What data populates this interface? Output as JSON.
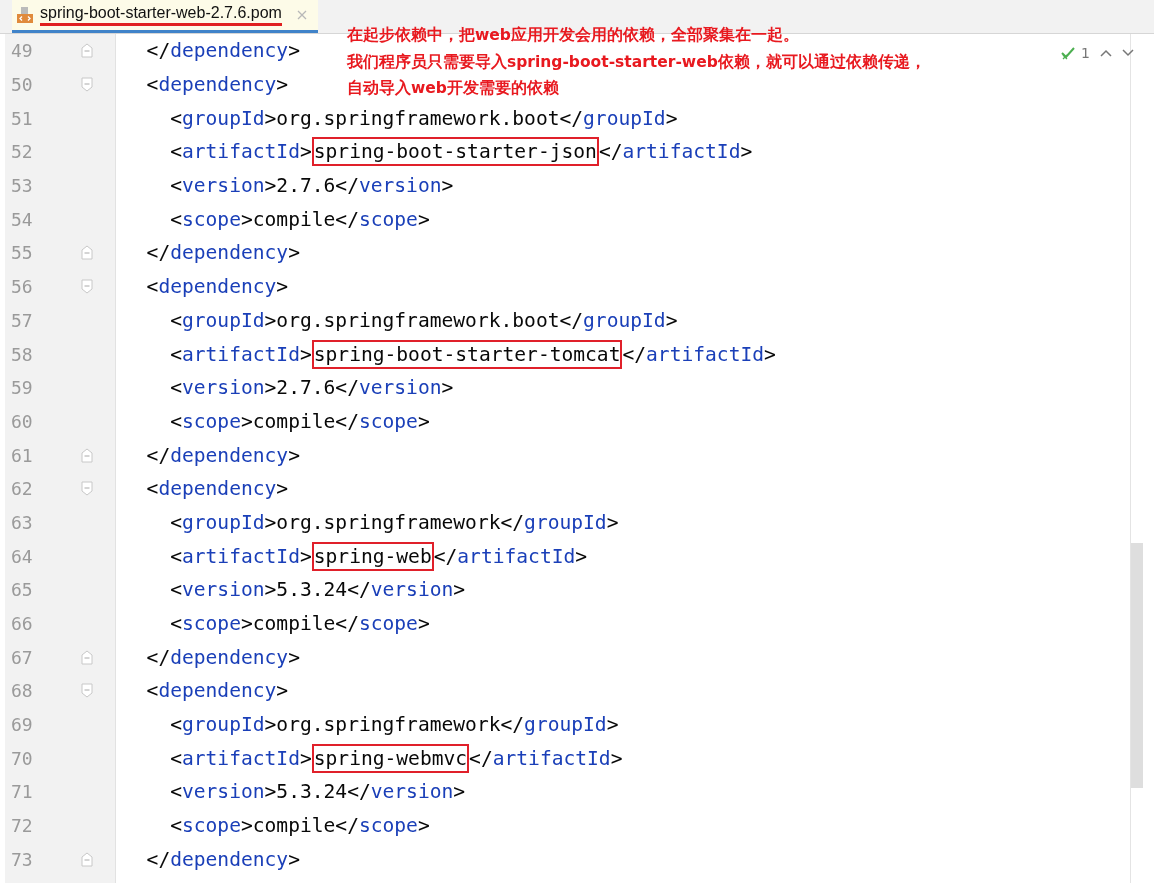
{
  "tab": {
    "title": "spring-boot-starter-web-2.7.6.pom",
    "closable": true,
    "selected": true,
    "underlined": true
  },
  "annotation": [
    "在起步依赖中，把web应用开发会用的依赖，全部聚集在一起。",
    "我们程序员只需要导入spring-boot-starter-web依赖，就可以通过依赖传递，",
    "自动导入web开发需要的依赖"
  ],
  "inspections": {
    "count": "1"
  },
  "lines": [
    {
      "number": "49",
      "fold_close": true,
      "tokens": [
        {
          "kind": "punct",
          "text": "  </"
        },
        {
          "kind": "tag",
          "text": "dependency"
        },
        {
          "kind": "punct",
          "text": ">"
        }
      ]
    },
    {
      "number": "50",
      "fold_open": true,
      "tokens": [
        {
          "kind": "punct",
          "text": "  <"
        },
        {
          "kind": "tag",
          "text": "dependency"
        },
        {
          "kind": "punct",
          "text": ">"
        }
      ]
    },
    {
      "number": "51",
      "tokens": [
        {
          "kind": "punct",
          "text": "    <"
        },
        {
          "kind": "tag",
          "text": "groupId"
        },
        {
          "kind": "punct",
          "text": ">"
        },
        {
          "kind": "text",
          "text": "org.springframework.boot"
        },
        {
          "kind": "punct",
          "text": "</"
        },
        {
          "kind": "tag",
          "text": "groupId"
        },
        {
          "kind": "punct",
          "text": ">"
        }
      ]
    },
    {
      "number": "52",
      "tokens": [
        {
          "kind": "punct",
          "text": "    <"
        },
        {
          "kind": "tag",
          "text": "artifactId"
        },
        {
          "kind": "punct",
          "text": ">"
        },
        {
          "kind": "text",
          "text": "spring-boot-starter-json",
          "boxed": true
        },
        {
          "kind": "punct",
          "text": "</"
        },
        {
          "kind": "tag",
          "text": "artifactId"
        },
        {
          "kind": "punct",
          "text": ">"
        }
      ]
    },
    {
      "number": "53",
      "tokens": [
        {
          "kind": "punct",
          "text": "    <"
        },
        {
          "kind": "tag",
          "text": "version"
        },
        {
          "kind": "punct",
          "text": ">"
        },
        {
          "kind": "text",
          "text": "2.7.6"
        },
        {
          "kind": "punct",
          "text": "</"
        },
        {
          "kind": "tag",
          "text": "version"
        },
        {
          "kind": "punct",
          "text": ">"
        }
      ]
    },
    {
      "number": "54",
      "tokens": [
        {
          "kind": "punct",
          "text": "    <"
        },
        {
          "kind": "tag",
          "text": "scope"
        },
        {
          "kind": "punct",
          "text": ">"
        },
        {
          "kind": "text",
          "text": "compile"
        },
        {
          "kind": "punct",
          "text": "</"
        },
        {
          "kind": "tag",
          "text": "scope"
        },
        {
          "kind": "punct",
          "text": ">"
        }
      ]
    },
    {
      "number": "55",
      "fold_close": true,
      "tokens": [
        {
          "kind": "punct",
          "text": "  </"
        },
        {
          "kind": "tag",
          "text": "dependency"
        },
        {
          "kind": "punct",
          "text": ">"
        }
      ]
    },
    {
      "number": "56",
      "fold_open": true,
      "tokens": [
        {
          "kind": "punct",
          "text": "  <"
        },
        {
          "kind": "tag",
          "text": "dependency"
        },
        {
          "kind": "punct",
          "text": ">"
        }
      ]
    },
    {
      "number": "57",
      "tokens": [
        {
          "kind": "punct",
          "text": "    <"
        },
        {
          "kind": "tag",
          "text": "groupId"
        },
        {
          "kind": "punct",
          "text": ">"
        },
        {
          "kind": "text",
          "text": "org.springframework.boot"
        },
        {
          "kind": "punct",
          "text": "</"
        },
        {
          "kind": "tag",
          "text": "groupId"
        },
        {
          "kind": "punct",
          "text": ">"
        }
      ]
    },
    {
      "number": "58",
      "tokens": [
        {
          "kind": "punct",
          "text": "    <"
        },
        {
          "kind": "tag",
          "text": "artifactId"
        },
        {
          "kind": "punct",
          "text": ">"
        },
        {
          "kind": "text",
          "text": "spring-boot-starter-tomcat",
          "boxed": true
        },
        {
          "kind": "punct",
          "text": "</"
        },
        {
          "kind": "tag",
          "text": "artifactId"
        },
        {
          "kind": "punct",
          "text": ">"
        }
      ]
    },
    {
      "number": "59",
      "tokens": [
        {
          "kind": "punct",
          "text": "    <"
        },
        {
          "kind": "tag",
          "text": "version"
        },
        {
          "kind": "punct",
          "text": ">"
        },
        {
          "kind": "text",
          "text": "2.7.6"
        },
        {
          "kind": "punct",
          "text": "</"
        },
        {
          "kind": "tag",
          "text": "version"
        },
        {
          "kind": "punct",
          "text": ">"
        }
      ]
    },
    {
      "number": "60",
      "tokens": [
        {
          "kind": "punct",
          "text": "    <"
        },
        {
          "kind": "tag",
          "text": "scope"
        },
        {
          "kind": "punct",
          "text": ">"
        },
        {
          "kind": "text",
          "text": "compile"
        },
        {
          "kind": "punct",
          "text": "</"
        },
        {
          "kind": "tag",
          "text": "scope"
        },
        {
          "kind": "punct",
          "text": ">"
        }
      ]
    },
    {
      "number": "61",
      "fold_close": true,
      "tokens": [
        {
          "kind": "punct",
          "text": "  </"
        },
        {
          "kind": "tag",
          "text": "dependency"
        },
        {
          "kind": "punct",
          "text": ">"
        }
      ]
    },
    {
      "number": "62",
      "fold_open": true,
      "tokens": [
        {
          "kind": "punct",
          "text": "  <"
        },
        {
          "kind": "tag",
          "text": "dependency"
        },
        {
          "kind": "punct",
          "text": ">"
        }
      ]
    },
    {
      "number": "63",
      "tokens": [
        {
          "kind": "punct",
          "text": "    <"
        },
        {
          "kind": "tag",
          "text": "groupId"
        },
        {
          "kind": "punct",
          "text": ">"
        },
        {
          "kind": "text",
          "text": "org.springframework"
        },
        {
          "kind": "punct",
          "text": "</"
        },
        {
          "kind": "tag",
          "text": "groupId"
        },
        {
          "kind": "punct",
          "text": ">"
        }
      ]
    },
    {
      "number": "64",
      "tokens": [
        {
          "kind": "punct",
          "text": "    <"
        },
        {
          "kind": "tag",
          "text": "artifactId"
        },
        {
          "kind": "punct",
          "text": ">"
        },
        {
          "kind": "text",
          "text": "spring-web",
          "boxed": true
        },
        {
          "kind": "punct",
          "text": "</"
        },
        {
          "kind": "tag",
          "text": "artifactId"
        },
        {
          "kind": "punct",
          "text": ">"
        }
      ]
    },
    {
      "number": "65",
      "tokens": [
        {
          "kind": "punct",
          "text": "    <"
        },
        {
          "kind": "tag",
          "text": "version"
        },
        {
          "kind": "punct",
          "text": ">"
        },
        {
          "kind": "text",
          "text": "5.3.24"
        },
        {
          "kind": "punct",
          "text": "</"
        },
        {
          "kind": "tag",
          "text": "version"
        },
        {
          "kind": "punct",
          "text": ">"
        }
      ]
    },
    {
      "number": "66",
      "tokens": [
        {
          "kind": "punct",
          "text": "    <"
        },
        {
          "kind": "tag",
          "text": "scope"
        },
        {
          "kind": "punct",
          "text": ">"
        },
        {
          "kind": "text",
          "text": "compile"
        },
        {
          "kind": "punct",
          "text": "</"
        },
        {
          "kind": "tag",
          "text": "scope"
        },
        {
          "kind": "punct",
          "text": ">"
        }
      ]
    },
    {
      "number": "67",
      "fold_close": true,
      "tokens": [
        {
          "kind": "punct",
          "text": "  </"
        },
        {
          "kind": "tag",
          "text": "dependency"
        },
        {
          "kind": "punct",
          "text": ">"
        }
      ]
    },
    {
      "number": "68",
      "fold_open": true,
      "tokens": [
        {
          "kind": "punct",
          "text": "  <"
        },
        {
          "kind": "tag",
          "text": "dependency"
        },
        {
          "kind": "punct",
          "text": ">"
        }
      ]
    },
    {
      "number": "69",
      "tokens": [
        {
          "kind": "punct",
          "text": "    <"
        },
        {
          "kind": "tag",
          "text": "groupId"
        },
        {
          "kind": "punct",
          "text": ">"
        },
        {
          "kind": "text",
          "text": "org.springframework"
        },
        {
          "kind": "punct",
          "text": "</"
        },
        {
          "kind": "tag",
          "text": "groupId"
        },
        {
          "kind": "punct",
          "text": ">"
        }
      ]
    },
    {
      "number": "70",
      "tokens": [
        {
          "kind": "punct",
          "text": "    <"
        },
        {
          "kind": "tag",
          "text": "artifactId"
        },
        {
          "kind": "punct",
          "text": ">"
        },
        {
          "kind": "text",
          "text": "spring-webmvc",
          "boxed": true
        },
        {
          "kind": "punct",
          "text": "</"
        },
        {
          "kind": "tag",
          "text": "artifactId"
        },
        {
          "kind": "punct",
          "text": ">"
        }
      ]
    },
    {
      "number": "71",
      "tokens": [
        {
          "kind": "punct",
          "text": "    <"
        },
        {
          "kind": "tag",
          "text": "version"
        },
        {
          "kind": "punct",
          "text": ">"
        },
        {
          "kind": "text",
          "text": "5.3.24"
        },
        {
          "kind": "punct",
          "text": "</"
        },
        {
          "kind": "tag",
          "text": "version"
        },
        {
          "kind": "punct",
          "text": ">"
        }
      ]
    },
    {
      "number": "72",
      "tokens": [
        {
          "kind": "punct",
          "text": "    <"
        },
        {
          "kind": "tag",
          "text": "scope"
        },
        {
          "kind": "punct",
          "text": ">"
        },
        {
          "kind": "text",
          "text": "compile"
        },
        {
          "kind": "punct",
          "text": "</"
        },
        {
          "kind": "tag",
          "text": "scope"
        },
        {
          "kind": "punct",
          "text": ">"
        }
      ]
    },
    {
      "number": "73",
      "fold_close": true,
      "tokens": [
        {
          "kind": "punct",
          "text": "  </"
        },
        {
          "kind": "tag",
          "text": "dependency"
        },
        {
          "kind": "punct",
          "text": ">"
        }
      ]
    }
  ]
}
